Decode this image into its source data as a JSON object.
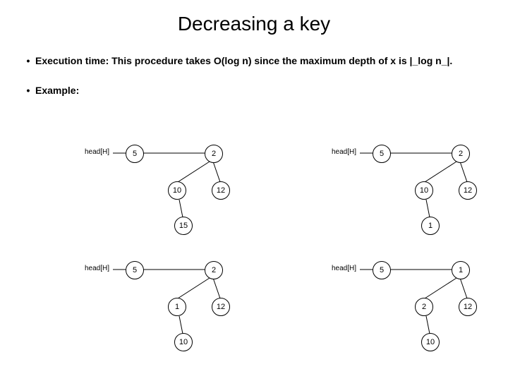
{
  "title": "Decreasing a key",
  "bullets": {
    "b1": "Execution time: This procedure takes O(log n) since the maximum depth of x is |_log n_|.",
    "b2": "Example:"
  },
  "head_label": "head[H]",
  "quads": {
    "q1": {
      "n_a": "5",
      "n_b": "2",
      "n_c": "10",
      "n_d": "12",
      "n_e": "15"
    },
    "q2": {
      "n_a": "5",
      "n_b": "2",
      "n_c": "10",
      "n_d": "12",
      "n_e": "1"
    },
    "q3": {
      "n_a": "5",
      "n_b": "2",
      "n_c": "1",
      "n_d": "12",
      "n_e": "10"
    },
    "q4": {
      "n_a": "5",
      "n_b": "1",
      "n_c": "2",
      "n_d": "12",
      "n_e": "10"
    }
  }
}
